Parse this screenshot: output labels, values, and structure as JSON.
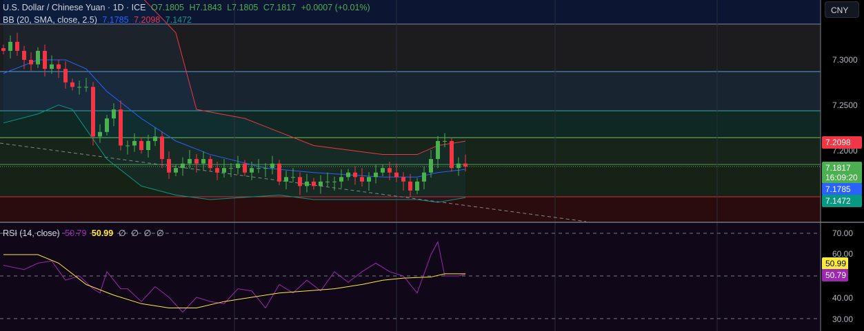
{
  "header": {
    "symbol": "U.S. Dollar / Chinese Yuan · 1D · ICE",
    "open": "O7.1805",
    "high": "H7.1843",
    "low": "L7.1805",
    "close": "C7.1817",
    "change": "+0.0007 (+0.01%)"
  },
  "bb": {
    "label": "BB (20, SMA, close, 2.5)",
    "basis": "7.1785",
    "upper": "7.2098",
    "lower": "7.1472"
  },
  "rsi": {
    "label": "RSI (14, close)",
    "value": "50.79",
    "ma": "50.99",
    "extras": [
      "∅",
      "∅",
      "∅",
      "∅"
    ]
  },
  "price_axis": {
    "currency": "CNY",
    "ticks": [
      "7.3000",
      "7.2500",
      "7.2000"
    ],
    "last_price": "7.1817",
    "countdown": "16:09:20",
    "upper_tag": "7.2098",
    "basis_tag": "7.1785",
    "lower_tag": "7.1472"
  },
  "rsi_axis": {
    "ticks": [
      "70.00",
      "60.00",
      "40.00",
      "30.00"
    ],
    "ma_tag": "50.99",
    "rsi_tag": "50.79"
  },
  "colors": {
    "up": "#4caf50",
    "down": "#f23645",
    "basis": "#2962ff",
    "upper": "#f23645",
    "lower": "#089981",
    "rsi": "#9c27b0",
    "rsi_ma": "#ffeb3b"
  },
  "chart_data": {
    "type": "candlestick",
    "closes": [
      7.31,
      7.32,
      7.31,
      7.3,
      7.295,
      7.31,
      7.29,
      7.295,
      7.29,
      7.275,
      7.27,
      7.27,
      7.27,
      7.215,
      7.22,
      7.235,
      7.245,
      7.205,
      7.205,
      7.21,
      7.2,
      7.21,
      7.215,
      7.19,
      7.175,
      7.18,
      7.185,
      7.19,
      7.185,
      7.19,
      7.18,
      7.175,
      7.18,
      7.18,
      7.185,
      7.175,
      7.18,
      7.18,
      7.18,
      7.185,
      7.165,
      7.17,
      7.17,
      7.16,
      7.165,
      7.16,
      7.165,
      7.165,
      7.165,
      7.17,
      7.175,
      7.17,
      7.165,
      7.17,
      7.175,
      7.18,
      7.175,
      7.17,
      7.165,
      7.155,
      7.165,
      7.175,
      7.19,
      7.21,
      7.21,
      7.18,
      7.185,
      7.1817
    ],
    "bb_upper": [
      [
        0,
        7.4
      ],
      [
        15,
        7.4
      ],
      [
        20,
        7.37
      ],
      [
        25,
        7.33
      ],
      [
        28,
        7.245
      ],
      [
        35,
        7.235
      ],
      [
        40,
        7.22
      ],
      [
        45,
        7.205
      ],
      [
        55,
        7.195
      ],
      [
        60,
        7.195
      ],
      [
        63,
        7.205
      ],
      [
        67,
        7.2098
      ]
    ],
    "bb_basis": [
      [
        0,
        7.285
      ],
      [
        5,
        7.3
      ],
      [
        9,
        7.3
      ],
      [
        12,
        7.29
      ],
      [
        15,
        7.265
      ],
      [
        20,
        7.235
      ],
      [
        25,
        7.21
      ],
      [
        30,
        7.195
      ],
      [
        38,
        7.18
      ],
      [
        45,
        7.175
      ],
      [
        55,
        7.17
      ],
      [
        60,
        7.17
      ],
      [
        63,
        7.175
      ],
      [
        67,
        7.1785
      ]
    ],
    "bb_lower": [
      [
        0,
        7.23
      ],
      [
        5,
        7.24
      ],
      [
        8,
        7.25
      ],
      [
        10,
        7.245
      ],
      [
        15,
        7.19
      ],
      [
        20,
        7.16
      ],
      [
        25,
        7.15
      ],
      [
        30,
        7.145
      ],
      [
        40,
        7.15
      ],
      [
        45,
        7.145
      ],
      [
        55,
        7.145
      ],
      [
        60,
        7.145
      ],
      [
        63,
        7.142
      ],
      [
        67,
        7.1472
      ]
    ],
    "rsi": [
      [
        0,
        55
      ],
      [
        3,
        53
      ],
      [
        5,
        56
      ],
      [
        7,
        57
      ],
      [
        9,
        48
      ],
      [
        11,
        50
      ],
      [
        13,
        44
      ],
      [
        14,
        42
      ],
      [
        15,
        52
      ],
      [
        17,
        44
      ],
      [
        18,
        44
      ],
      [
        20,
        38
      ],
      [
        22,
        45
      ],
      [
        24,
        40
      ],
      [
        26,
        33
      ],
      [
        28,
        40
      ],
      [
        30,
        38
      ],
      [
        32,
        37
      ],
      [
        34,
        44
      ],
      [
        36,
        43
      ],
      [
        38,
        35
      ],
      [
        40,
        46
      ],
      [
        42,
        42
      ],
      [
        44,
        48
      ],
      [
        46,
        43
      ],
      [
        48,
        52
      ],
      [
        50,
        47
      ],
      [
        52,
        52
      ],
      [
        54,
        56
      ],
      [
        56,
        52
      ],
      [
        58,
        50
      ],
      [
        60,
        42
      ],
      [
        62,
        60
      ],
      [
        63,
        66
      ],
      [
        64,
        50
      ],
      [
        66,
        50
      ],
      [
        67,
        50.79
      ]
    ],
    "rsi_ma": [
      [
        0,
        60
      ],
      [
        5,
        60
      ],
      [
        8,
        56
      ],
      [
        12,
        46
      ],
      [
        16,
        41
      ],
      [
        20,
        37
      ],
      [
        24,
        35
      ],
      [
        28,
        35
      ],
      [
        32,
        38
      ],
      [
        36,
        40
      ],
      [
        40,
        42
      ],
      [
        44,
        43
      ],
      [
        48,
        44
      ],
      [
        52,
        46
      ],
      [
        55,
        48
      ],
      [
        58,
        49
      ],
      [
        62,
        49.5
      ],
      [
        64,
        51
      ],
      [
        67,
        50.99
      ]
    ],
    "price_range": [
      7.1,
      7.35
    ],
    "rsi_range": [
      30,
      70
    ]
  }
}
